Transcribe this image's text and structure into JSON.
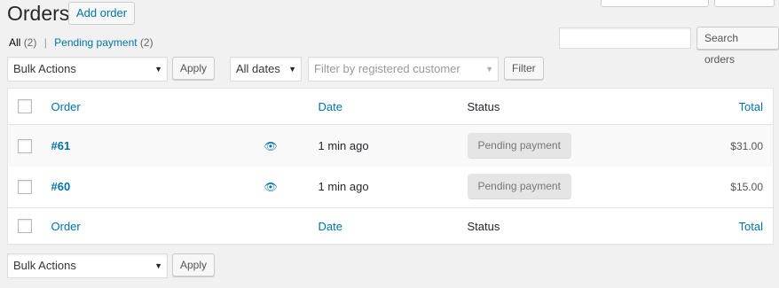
{
  "header": {
    "title": "Orders",
    "add_order_label": "Add order"
  },
  "filters": {
    "all_label": "All",
    "all_count": "(2)",
    "separator": "|",
    "pending_label": "Pending payment",
    "pending_count": "(2)"
  },
  "search": {
    "value": "",
    "button_label": "Search orders"
  },
  "toolbar": {
    "bulk_actions_label": "Bulk Actions",
    "apply_label": "Apply",
    "dates_label": "All dates",
    "customer_placeholder": "Filter by registered customer",
    "filter_label": "Filter"
  },
  "table": {
    "columns": {
      "order": "Order",
      "date": "Date",
      "status": "Status",
      "total": "Total"
    },
    "rows": [
      {
        "order": "#61",
        "date": "1 min ago",
        "status": "Pending payment",
        "total": "$31.00"
      },
      {
        "order": "#60",
        "date": "1 min ago",
        "status": "Pending payment",
        "total": "$15.00"
      }
    ]
  },
  "bottom_toolbar": {
    "bulk_actions_label": "Bulk Actions",
    "apply_label": "Apply"
  },
  "colors": {
    "link": "#0073aa",
    "background": "#f1f1f1",
    "status_badge": "#e5e5e5"
  },
  "icons": {
    "preview": "eye-icon",
    "dropdown": "chevron-down-icon"
  }
}
